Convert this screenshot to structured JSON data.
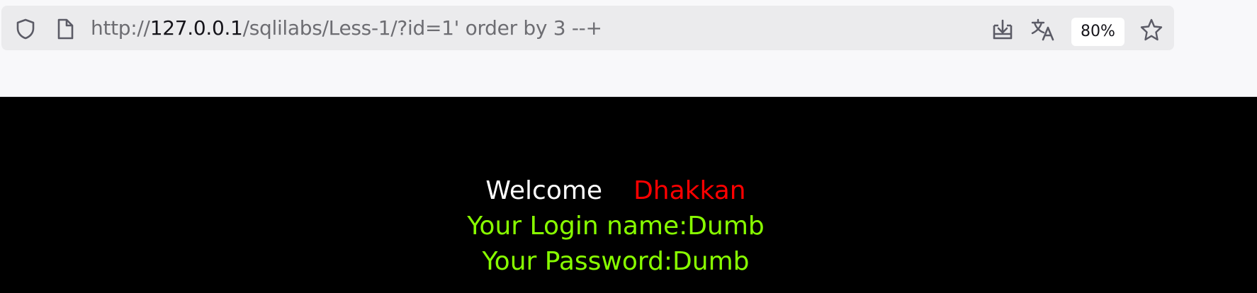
{
  "browser": {
    "url_prefix": "http://",
    "url_host": "127.0.0.1",
    "url_path": "/sqlilabs/Less-1/?id=1' order by 3 --+",
    "zoom": "80%"
  },
  "page": {
    "welcome_word": "Welcome",
    "user_name": "Dhakkan",
    "login_line": "Your Login name:Dumb",
    "password_line": "Your Password:Dumb",
    "colors": {
      "background": "#000000",
      "welcome": "#ffffff",
      "name": "#ff0000",
      "result": "#88ff00"
    }
  }
}
